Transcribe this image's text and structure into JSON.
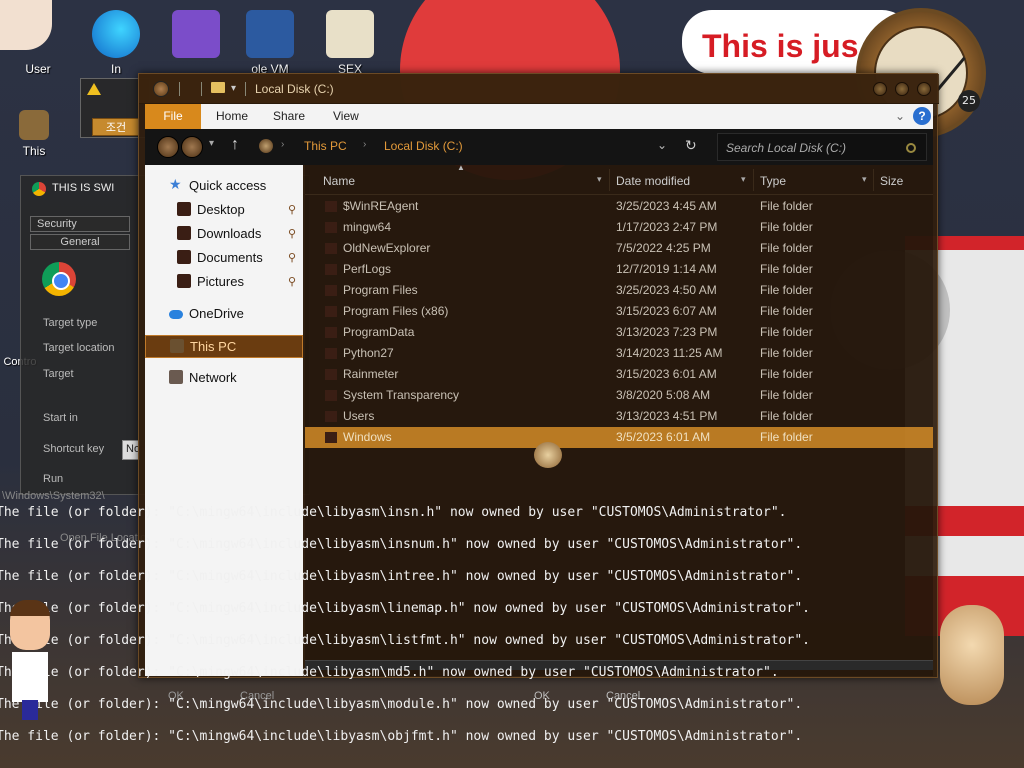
{
  "desktop": {
    "icons": [
      {
        "name": "user-desktop-icon",
        "label": "User"
      },
      {
        "name": "edge-desktop-icon",
        "label": "In"
      },
      {
        "name": "visual-studio-desktop-icon",
        "label": ""
      },
      {
        "name": "virtualbox-desktop-icon",
        "label": "ole VM"
      },
      {
        "name": "hxd-desktop-icon",
        "label": "SEX"
      }
    ],
    "banner_text": "This is jus",
    "clock_date": "25",
    "partial_label_this": "This",
    "partial_label_contro": "Contro",
    "chrome_title": "THIS IS SWI",
    "warn_button": "조건"
  },
  "ghost_props": {
    "tabs": [
      "Security",
      "General"
    ],
    "labels": {
      "target_type": "Target type",
      "target_location": "Target location",
      "target": "Target",
      "start_in": "Start in",
      "shortcut_key": "Shortcut key",
      "shortcut_value": "None",
      "run": "Run",
      "open_file_location": "Open File Locatio",
      "path_text": "\\Windows\\System32\\",
      "ok": "OK",
      "cancel": "Cancel"
    }
  },
  "explorer": {
    "title": "Local Disk (C:)",
    "ribbon_tabs": [
      "File",
      "Home",
      "Share",
      "View"
    ],
    "help": "?",
    "breadcrumb": [
      "This PC",
      "Local Disk (C:)"
    ],
    "search_placeholder": "Search Local Disk (C:)",
    "nav": {
      "quick_access": "Quick access",
      "pinned": [
        "Desktop",
        "Downloads",
        "Documents",
        "Pictures"
      ],
      "onedrive": "OneDrive",
      "this_pc": "This PC",
      "network": "Network"
    },
    "columns": {
      "name": "Name",
      "date": "Date modified",
      "type": "Type",
      "size": "Size"
    },
    "files": [
      {
        "name": "$WinREAgent",
        "date": "3/25/2023 4:45 AM",
        "type": "File folder"
      },
      {
        "name": "mingw64",
        "date": "1/17/2023 2:47 PM",
        "type": "File folder"
      },
      {
        "name": "OldNewExplorer",
        "date": "7/5/2022 4:25 PM",
        "type": "File folder"
      },
      {
        "name": "PerfLogs",
        "date": "12/7/2019 1:14 AM",
        "type": "File folder"
      },
      {
        "name": "Program Files",
        "date": "3/25/2023 4:50 AM",
        "type": "File folder"
      },
      {
        "name": "Program Files (x86)",
        "date": "3/15/2023 6:07 AM",
        "type": "File folder"
      },
      {
        "name": "ProgramData",
        "date": "3/13/2023 7:23 PM",
        "type": "File folder"
      },
      {
        "name": "Python27",
        "date": "3/14/2023 11:25 AM",
        "type": "File folder"
      },
      {
        "name": "Rainmeter",
        "date": "3/15/2023 6:01 AM",
        "type": "File folder"
      },
      {
        "name": "System Transparency",
        "date": "3/8/2020 5:08 AM",
        "type": "File folder"
      },
      {
        "name": "Users",
        "date": "3/13/2023 4:51 PM",
        "type": "File folder"
      },
      {
        "name": "Windows",
        "date": "3/5/2023 6:01 AM",
        "type": "File folder"
      }
    ],
    "selected_index": 11
  },
  "console": {
    "lines": [
      "The file (or folder): \"C:\\mingw64\\include\\libyasm\\insn.h\" now owned by user \"CUSTOMOS\\Administrator\".",
      "The file (or folder): \"C:\\mingw64\\include\\libyasm\\insnum.h\" now owned by user \"CUSTOMOS\\Administrator\".",
      "The file (or folder): \"C:\\mingw64\\include\\libyasm\\intree.h\" now owned by user \"CUSTOMOS\\Administrator\".",
      "The file (or folder): \"C:\\mingw64\\include\\libyasm\\linemap.h\" now owned by user \"CUSTOMOS\\Administrator\".",
      "The file (or folder): \"C:\\mingw64\\include\\libyasm\\listfmt.h\" now owned by user \"CUSTOMOS\\Administrator\".",
      "The file (or folder): \"C:\\mingw64\\include\\libyasm\\md5.h\" now owned by user \"CUSTOMOS\\Administrator\".",
      "The file (or folder): \"C:\\mingw64\\include\\libyasm\\module.h\" now owned by user \"CUSTOMOS\\Administrator\".",
      "The file (or folder): \"C:\\mingw64\\include\\libyasm\\objfmt.h\" now owned by user \"CUSTOMOS\\Administrator\"."
    ]
  },
  "colors": {
    "accent": "#d8891c",
    "explorer_bg": "#301e0e",
    "breadcrumb": "#e39a3a",
    "banner_red": "#d61c24"
  }
}
